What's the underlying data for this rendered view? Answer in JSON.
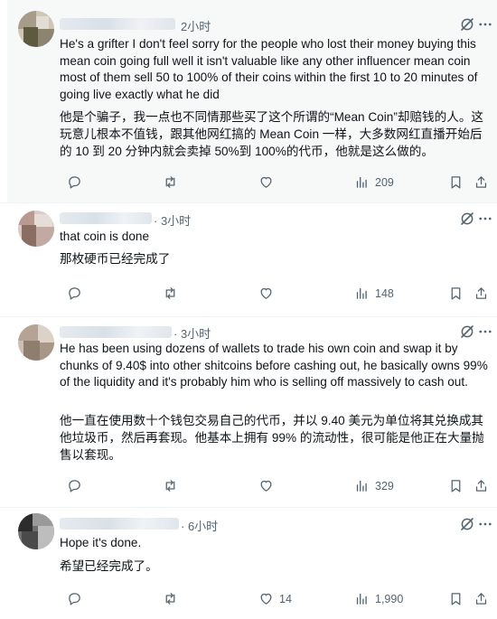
{
  "posts": [
    {
      "time": "2小时",
      "text_en": "He's a grifter I don't feel sorry for the people who lost their money buying this mean coin going full well it isn't valuable like any other influencer mean coin most of them sell 50 to 100% of their coins within the first 10 to 20 minutes of going live exactly what he did",
      "text_zh": "他是个骗子，我一点也不同情那些买了这个所谓的“Mean Coin”却赔钱的人。这玩意儿根本不值钱，跟其他网红搞的 Mean Coin 一样，大多数网红直播开始后的 10 到 20 分钟内就会卖掉 50%到 100%的代币，他就是这么做的。",
      "likes": "",
      "views": "209"
    },
    {
      "time": "· 3小时",
      "text_en": "that coin is done",
      "text_zh": "那枚硬币已经完成了",
      "likes": "",
      "views": "148"
    },
    {
      "time": "· 3小时",
      "text_en": "He has been using dozens of wallets to trade his own coin and swap it by chunks of 9.40$ into other shitcoins before cashing out, he basically owns 99% of the liquidity and it's probably him who is selling off massively to cash out.",
      "text_zh": "他一直在使用数十个钱包交易自己的代币，并以 9.40 美元为单位将其兑换成其他垃圾币，然后再套现。他基本上拥有 99% 的流动性，很可能是他正在大量抛售以套现。",
      "likes": "",
      "views": "329"
    },
    {
      "time": "· 6小时",
      "text_en": "Hope it's done.",
      "text_zh": "希望已经完成了。",
      "likes": "14",
      "views": "1,990"
    }
  ],
  "icons": {
    "reply": "reply-icon",
    "repost": "repost-icon",
    "like": "like-icon",
    "views": "views-icon",
    "bookmark": "bookmark-icon",
    "share": "share-icon",
    "grok": "grok-icon",
    "more": "more-icon"
  },
  "colors": {
    "meta": "#536471",
    "text": "#0f1419",
    "highlight_bg": "#f7f9f9"
  }
}
